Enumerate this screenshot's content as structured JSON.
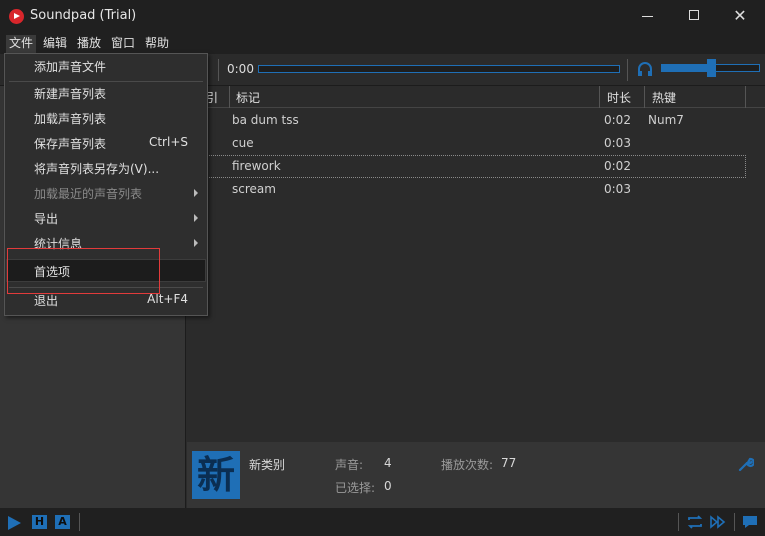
{
  "window": {
    "title": "Soundpad (Trial)"
  },
  "menubar": {
    "items": [
      "文件",
      "编辑",
      "播放",
      "窗口",
      "帮助"
    ]
  },
  "toolbar": {
    "time": "0:00",
    "seek_progress": 0.0,
    "volume_level": 0.5
  },
  "table": {
    "headers": {
      "index": "引",
      "tag": "标记",
      "duration": "时长",
      "hotkey": "热键"
    },
    "rows": [
      {
        "tag": "ba dum tss",
        "duration": "0:02",
        "hotkey": "Num7"
      },
      {
        "tag": "cue",
        "duration": "0:03",
        "hotkey": ""
      },
      {
        "tag": "firework",
        "duration": "0:02",
        "hotkey": ""
      },
      {
        "tag": "scream",
        "duration": "0:03",
        "hotkey": ""
      }
    ]
  },
  "file_menu": {
    "add_sound_file": "添加声音文件",
    "new_sound_list": "新建声音列表",
    "load_sound_list": "加载声音列表",
    "save_sound_list": "保存声音列表",
    "save_shortcut": "Ctrl+S",
    "save_sound_list_as": "将声音列表另存为(V)...",
    "load_recent": "加载最近的声音列表",
    "export": "导出",
    "statistics": "统计信息",
    "preferences": "首选项",
    "exit": "退出",
    "exit_shortcut": "Alt+F4"
  },
  "info": {
    "category_icon_char": "新",
    "category_name": "新类别",
    "sounds_label": "声音:",
    "sounds_value": "4",
    "plays_label": "播放次数:",
    "plays_value": "77",
    "selected_label": "已选择:",
    "selected_value": "0"
  },
  "statusbar": {
    "h_label": "H",
    "a_label": "A"
  },
  "colors": {
    "accent": "#1f6fb6",
    "highlight_box": "#e23b3b"
  }
}
